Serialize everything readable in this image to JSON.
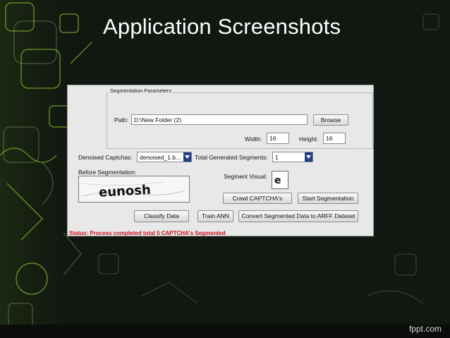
{
  "slide": {
    "title": "Application Screenshots",
    "watermark": "fppt.com"
  },
  "app": {
    "group_title": "Segmentation Parameters",
    "path_label": "Path:",
    "path_value": "D:\\New Folder (2)",
    "browse_label": "Browse",
    "width_label": "Width:",
    "width_value": "16",
    "height_label": "Height:",
    "height_value": "16",
    "denoised_label": "Denoised Captchas:",
    "denoised_value": "denoised_1.b...",
    "total_segments_label": "Total Generated Segments:",
    "total_segments_value": "1",
    "before_label": "Before Segmentation:",
    "captcha_text": "eunosh",
    "segment_visual_label": "Segment Visual:",
    "segment_glyph": "e",
    "crawl_label": "Crawl CAPTCHA's",
    "start_label": "Start Segmentation",
    "classify_label": "Classify Data",
    "train_label": "Train ANN",
    "convert_label": "Convert Segmented Data to ARFF Dataset",
    "status_text": "Status: Process completed total 5 CAPTCHA's Segmented"
  },
  "colors": {
    "status": "#c8101a",
    "combo_arrow": "#1f3f8a",
    "background": "#101510"
  }
}
